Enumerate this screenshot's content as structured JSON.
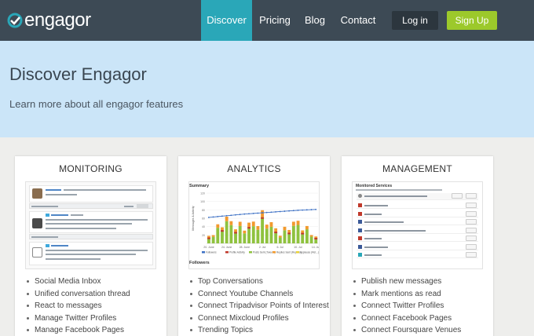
{
  "nav": {
    "logo_text": "engagor",
    "links": [
      "Discover",
      "Pricing",
      "Blog",
      "Contact"
    ],
    "active": "Discover",
    "login_label": "Log in",
    "signup_label": "Sign Up"
  },
  "colors": {
    "nav_bg": "#3d4a55",
    "active_tab": "#2aa7b8",
    "signup": "#9cc92b",
    "hero_bg": "#cbe5f8",
    "brand_accent": "#2aa7b8"
  },
  "icons": [
    "engagor-logo-icon",
    "twitter-bird-icon",
    "facebook-icon"
  ],
  "hero": {
    "title": "Discover Engagor",
    "subtitle": "Learn more about all engagor features"
  },
  "cards": [
    {
      "title": "MONITORING",
      "features": [
        "Social Media Inbox",
        "Unified conversation thread",
        "React to messages",
        "Manage Twitter Profiles",
        "Manage Facebook Pages"
      ]
    },
    {
      "title": "ANALYTICS",
      "features": [
        "Top Conversations",
        "Connect Youtube Channels",
        "Connect Tripadvisor Points of Interest",
        "Connect Mixcloud Profiles",
        "Trending Topics"
      ]
    },
    {
      "title": "MANAGEMENT",
      "features": [
        "Publish new messages",
        "Mark mentions as read",
        "Connect Twitter Profiles",
        "Connect Facebook Pages",
        "Connect Foursquare Venues"
      ]
    }
  ],
  "analytics_shot": {
    "summary_label": "Summary",
    "followers_label": "Followers",
    "x_labels": [
      "20. June",
      "24. June",
      "28. June",
      "2. Jul",
      "6. Jul",
      "10. Jul",
      "14. Jul"
    ],
    "y_ticks": [
      20,
      40,
      60,
      80,
      100,
      120
    ],
    "legend": [
      "Followers",
      "Profile Activity",
      "Posts Sent (Tweets)",
      "Replies Sent (Replies)",
      "Applause (Ret...)"
    ]
  },
  "management_shot": {
    "header": "Monitored Services",
    "first_row": "Keyword Search",
    "rows": [
      "Coca-Cola light",
      "Coca-Cola",
      "Coca-Cola Headquarters",
      "The Coca-Cola Company UK Headquarters",
      "Coca-Cola",
      "Coca-Cola Zero",
      "Coke Zone"
    ],
    "edit_label": "Edit",
    "delete_label": "Delete"
  },
  "monitoring_shot": {
    "first_author": "Glenn Goossens",
    "first_location": "Guggenheim New York",
    "likes_label": "Likes",
    "second_author": "Design Milk",
    "third_author": "Design Milk"
  },
  "chart_data": {
    "type": "bar",
    "title": "Summary",
    "ylabel": "Messages & Activity",
    "ylim": [
      0,
      120
    ],
    "categories": [
      "20. June",
      "24. June",
      "28. June",
      "2. Jul",
      "6. Jul",
      "10. Jul",
      "14. Jul"
    ],
    "series": [
      {
        "name": "Posts Sent (Tweets)",
        "values": [
          14,
          48,
          30,
          52,
          20,
          44,
          12
        ]
      },
      {
        "name": "Replies Sent (Replies)",
        "values": [
          4,
          10,
          8,
          14,
          6,
          10,
          3
        ]
      },
      {
        "name": "Followers",
        "values": [
          62,
          66,
          70,
          73,
          76,
          79,
          81
        ]
      }
    ]
  }
}
